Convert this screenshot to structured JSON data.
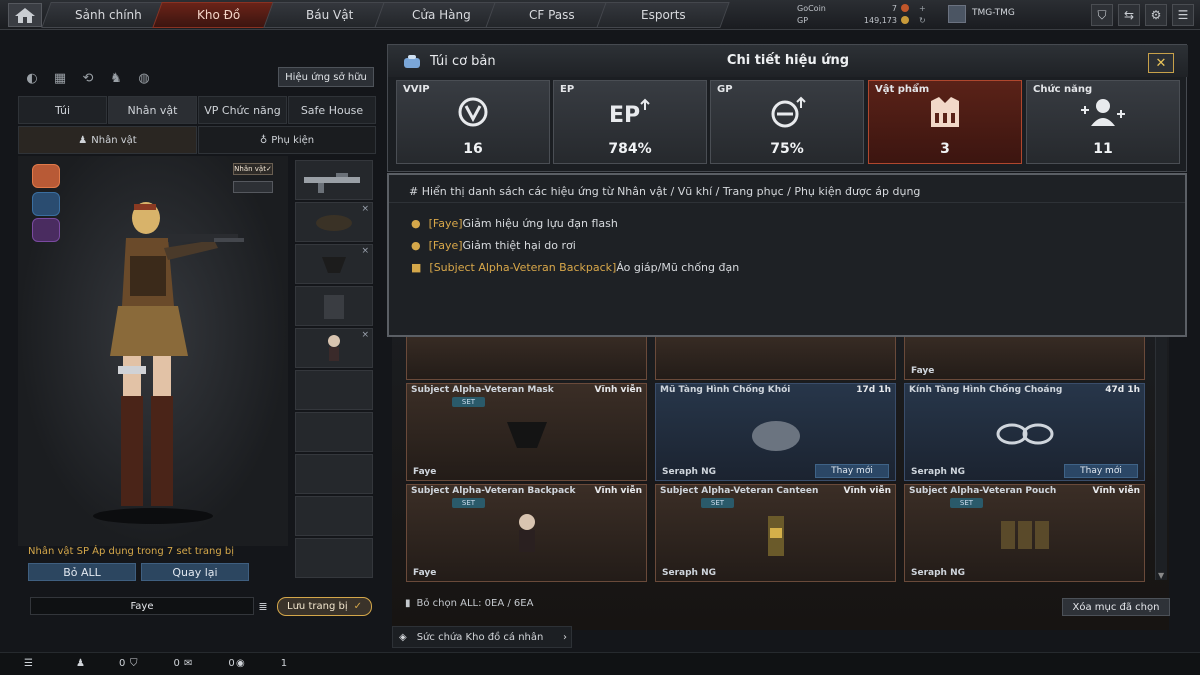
{
  "nav": {
    "tabs": [
      {
        "label": "Sảnh chính"
      },
      {
        "label": "Kho Đồ"
      },
      {
        "label": "Báu Vật"
      },
      {
        "label": "Cửa Hàng"
      },
      {
        "label": "CF Pass"
      },
      {
        "label": "Esports"
      }
    ],
    "active_tab": "Kho Đồ",
    "gocoin_label": "GoCoin",
    "gocoin_value": "7",
    "gp_label": "GP",
    "gp_value": "149,173",
    "username": "TMG-TMG",
    "icons": [
      "home-icon",
      "shield-icon",
      "swap-icon",
      "gear-icon",
      "menu-icon"
    ]
  },
  "left": {
    "effects_owned_label": "Hiệu ứng sở hữu",
    "tabs": [
      "Túi",
      "Nhân vật",
      "VP Chức năng",
      "Safe House"
    ],
    "subtabs": [
      "Nhân vật",
      "Phụ kiện"
    ],
    "char_tag": "Nhân vật",
    "set_note": "Nhân vật SP Áp dụng trong 7 set trang bị",
    "remove_all": "Bỏ ALL",
    "go_back": "Quay lại",
    "name_field": "Faye",
    "save_outfit": "Lưu trang bị"
  },
  "popup": {
    "bag_title": "Túi cơ bản",
    "title": "Chi tiết hiệu ứng",
    "stats": [
      {
        "name": "VVIP",
        "value": "16",
        "icon": "vvip-icon"
      },
      {
        "name": "EP",
        "value": "784%",
        "icon": "ep-icon"
      },
      {
        "name": "GP",
        "value": "75%",
        "icon": "gp-icon"
      },
      {
        "name": "Vật phẩm",
        "value": "3",
        "icon": "vest-icon"
      },
      {
        "name": "Chức năng",
        "value": "11",
        "icon": "add-users-icon"
      }
    ],
    "active_stat": "Vật phẩm",
    "list_header": "# Hiển thị danh sách các hiệu ứng từ Nhân vật / Vũ khí / Trang phục / Phụ kiện được áp dụng",
    "effects": [
      {
        "source": "[Faye]",
        "desc": "Giảm hiệu ứng lựu đạn flash"
      },
      {
        "source": "[Faye]",
        "desc": "Giảm thiệt hại do rơi"
      },
      {
        "source": "[Subject Alpha-Veteran Backpack]",
        "desc": "Áo giáp/Mũ chống đạn"
      }
    ]
  },
  "grid": {
    "top_row_owner": "Faye",
    "items": [
      {
        "name": "Subject Alpha-Veteran Mask",
        "duration": "Vĩnh viễn",
        "set": "SET",
        "owner": "Faye",
        "renew": "",
        "style": "brown"
      },
      {
        "name": "Mũ Tàng Hình Chống Khói",
        "duration": "17d 1h",
        "set": "",
        "owner": "Seraph NG",
        "renew": "Thay mới",
        "style": "blue"
      },
      {
        "name": "Kính Tàng Hình Chống Choáng",
        "duration": "47d 1h",
        "set": "",
        "owner": "Seraph NG",
        "renew": "Thay mới",
        "style": "blue"
      },
      {
        "name": "Subject Alpha-Veteran Backpack",
        "duration": "Vĩnh viễn",
        "set": "SET",
        "owner": "Faye",
        "renew": "",
        "style": "brown"
      },
      {
        "name": "Subject Alpha-Veteran Canteen",
        "duration": "Vĩnh viễn",
        "set": "SET",
        "owner": "Seraph NG",
        "renew": "",
        "style": "brown"
      },
      {
        "name": "Subject Alpha-Veteran Pouch",
        "duration": "Vĩnh viễn",
        "set": "SET",
        "owner": "Seraph NG",
        "renew": "",
        "style": "brown"
      }
    ],
    "deselect_all": "Bỏ chọn ALL: 0EA / 6EA",
    "clear_selected": "Xóa mục đã chọn",
    "capacity": "Sức chứa Kho đồ cá nhân"
  },
  "bottom": {
    "counts": [
      "0",
      "0",
      "0",
      "1"
    ]
  },
  "colors": {
    "accent_gold": "#d4a74a",
    "active_red": "#6a2318",
    "button_blue": "#2c4660"
  }
}
